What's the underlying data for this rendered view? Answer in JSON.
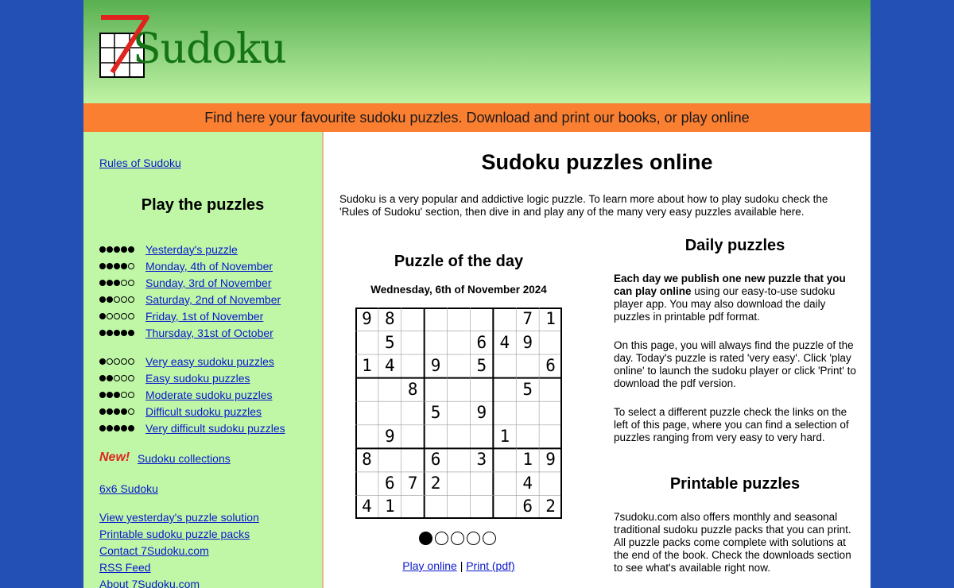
{
  "header": {
    "logo_numeral": "7",
    "logo_text": "Sudoku",
    "tagline": "Find here your favourite sudoku puzzles. Download and print our books, or play online"
  },
  "sidebar": {
    "rules_link": "Rules of Sudoku",
    "play_title": "Play the puzzles",
    "recent": [
      {
        "level": 5,
        "label": "Yesterday's puzzle"
      },
      {
        "level": 4,
        "label": "Monday, 4th of November"
      },
      {
        "level": 3,
        "label": "Sunday, 3rd of November"
      },
      {
        "level": 2,
        "label": "Saturday, 2nd of November"
      },
      {
        "level": 1,
        "label": "Friday, 1st of November"
      },
      {
        "level": 5,
        "label": "Thursday, 31st of October"
      }
    ],
    "categories": [
      {
        "level": 1,
        "label": "Very easy sudoku puzzles"
      },
      {
        "level": 2,
        "label": "Easy sudoku puzzles"
      },
      {
        "level": 3,
        "label": "Moderate sudoku puzzles"
      },
      {
        "level": 4,
        "label": "Difficult sudoku puzzles"
      },
      {
        "level": 5,
        "label": "Very difficult sudoku puzzles"
      }
    ],
    "new_label": "New!",
    "collections_link": "Sudoku collections",
    "six_by_six_link": "6x6 Sudoku",
    "bottom_links": [
      "View yesterday's puzzle solution",
      "Printable sudoku puzzle packs",
      "Contact 7Sudoku.com",
      "RSS Feed",
      "About 7Sudoku.com"
    ]
  },
  "main": {
    "title": "Sudoku puzzles online",
    "intro": "Sudoku is a very popular and addictive logic puzzle. To learn more about how to play sudoku check the 'Rules of Sudoku' section, then dive in and play any of the many very easy puzzles available here.",
    "potd_title": "Puzzle of the day",
    "potd_date": "Wednesday, 6th of November 2024",
    "grid": [
      [
        "9",
        "8",
        "",
        "",
        "",
        "",
        "",
        "7",
        "1"
      ],
      [
        "",
        "5",
        "",
        "",
        "",
        "6",
        "4",
        "9",
        ""
      ],
      [
        "1",
        "4",
        "",
        "9",
        "",
        "5",
        "",
        "",
        "6"
      ],
      [
        "",
        "",
        "8",
        "",
        "",
        "",
        "",
        "5",
        ""
      ],
      [
        "",
        "",
        "",
        "5",
        "",
        "9",
        "",
        "",
        ""
      ],
      [
        "",
        "9",
        "",
        "",
        "",
        "",
        "1",
        "",
        ""
      ],
      [
        "8",
        "",
        "",
        "6",
        "",
        "3",
        "",
        "1",
        "9"
      ],
      [
        "",
        "6",
        "7",
        "2",
        "",
        "",
        "",
        "4",
        ""
      ],
      [
        "4",
        "1",
        "",
        "",
        "",
        "",
        "",
        "6",
        "2"
      ]
    ],
    "difficulty_level": 1,
    "difficulty_max": 5,
    "play_online": "Play online",
    "separator": "|",
    "print_pdf": "Print (pdf)",
    "daily_title": "Daily puzzles",
    "daily_bold": "Each day we publish one new puzzle that you can play online",
    "daily_rest": " using our easy-to-use sudoku player app. You may also download the daily puzzles in printable pdf format.",
    "daily_p2": "On this page, you will always find the puzzle of the day. Today's puzzle is rated 'very easy'. Click 'play online' to launch the sudoku player or click 'Print' to download the pdf version.",
    "daily_p3": "To select a different puzzle check the links on the left of this page, where you can find a selection of puzzles ranging from very easy to very hard.",
    "printable_title": "Printable puzzles",
    "printable_p": "7sudoku.com also offers monthly and seasonal traditional sudoku puzzle packs that you can print. All puzzle packs come complete with solutions at the end of the book. Check the downloads section to see what's available right now."
  },
  "colors": {
    "background": "#2250b4",
    "tagline_bar": "#fb7f31",
    "sidebar": "#bff7a7",
    "logo_text": "#147314",
    "logo_seven": "#e0231e",
    "new_label": "#e0231e",
    "link": "#0a18cc"
  }
}
